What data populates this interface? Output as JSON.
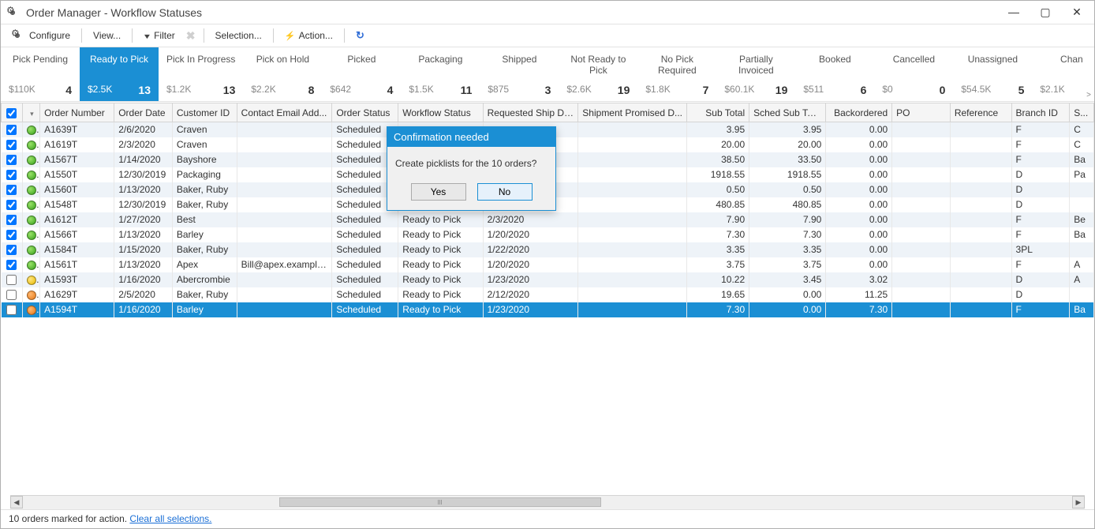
{
  "window": {
    "title": "Order Manager - Workflow Statuses"
  },
  "toolbar": {
    "configure": "Configure",
    "view": "View...",
    "filter": "Filter",
    "selection": "Selection...",
    "action": "Action...",
    "refresh": ""
  },
  "tabs": [
    {
      "name": "Pick Pending",
      "amount": "$110K",
      "count": "4"
    },
    {
      "name": "Ready to Pick",
      "amount": "$2.5K",
      "count": "13"
    },
    {
      "name": "Pick In Progress",
      "amount": "$1.2K",
      "count": "13"
    },
    {
      "name": "Pick on Hold",
      "amount": "$2.2K",
      "count": "8"
    },
    {
      "name": "Picked",
      "amount": "$642",
      "count": "4"
    },
    {
      "name": "Packaging",
      "amount": "$1.5K",
      "count": "11"
    },
    {
      "name": "Shipped",
      "amount": "$875",
      "count": "3"
    },
    {
      "name": "Not Ready to Pick",
      "amount": "$2.6K",
      "count": "19"
    },
    {
      "name": "No Pick Required",
      "amount": "$1.8K",
      "count": "7"
    },
    {
      "name": "Partially Invoiced",
      "amount": "$60.1K",
      "count": "19"
    },
    {
      "name": "Booked",
      "amount": "$511",
      "count": "6"
    },
    {
      "name": "Cancelled",
      "amount": "$0",
      "count": "0"
    },
    {
      "name": "Unassigned",
      "amount": "$54.5K",
      "count": "5"
    },
    {
      "name": "Chan",
      "amount": "$2.1K",
      "count": ""
    }
  ],
  "columns": {
    "order_number": "Order Number",
    "order_date": "Order Date",
    "customer_id": "Customer ID",
    "contact_email": "Contact Email Add...",
    "order_status": "Order Status",
    "workflow_status": "Workflow Status",
    "requested_ship": "Requested Ship Date",
    "promised": "Shipment Promised D...",
    "sub_total": "Sub Total",
    "sched_sub_total": "Sched Sub Total",
    "backordered": "Backordered",
    "po": "PO",
    "reference": "Reference",
    "branch_id": "Branch ID",
    "last": "S..."
  },
  "rows": [
    {
      "chk": true,
      "dot": "green",
      "num": "A1639T",
      "date": "2/6/2020",
      "cust": "Craven",
      "email": "",
      "ostat": "Scheduled",
      "wstat": "",
      "req": "",
      "prom": "",
      "sub": "3.95",
      "sched": "3.95",
      "back": "0.00",
      "po": "",
      "ref": "",
      "branch": "F",
      "last": "C"
    },
    {
      "chk": true,
      "dot": "green",
      "num": "A1619T",
      "date": "2/3/2020",
      "cust": "Craven",
      "email": "",
      "ostat": "Scheduled",
      "wstat": "",
      "req": "",
      "prom": "",
      "sub": "20.00",
      "sched": "20.00",
      "back": "0.00",
      "po": "",
      "ref": "",
      "branch": "F",
      "last": "C"
    },
    {
      "chk": true,
      "dot": "green",
      "num": "A1567T",
      "date": "1/14/2020",
      "cust": "Bayshore",
      "email": "",
      "ostat": "Scheduled",
      "wstat": "",
      "req": "",
      "prom": "",
      "sub": "38.50",
      "sched": "33.50",
      "back": "0.00",
      "po": "",
      "ref": "",
      "branch": "F",
      "last": "Ba"
    },
    {
      "chk": true,
      "dot": "green",
      "num": "A1550T",
      "date": "12/30/2019",
      "cust": "Packaging",
      "email": "",
      "ostat": "Scheduled",
      "wstat": "",
      "req": "",
      "prom": "",
      "sub": "1918.55",
      "sched": "1918.55",
      "back": "0.00",
      "po": "",
      "ref": "",
      "branch": "D",
      "last": "Pa"
    },
    {
      "chk": true,
      "dot": "green",
      "num": "A1560T",
      "date": "1/13/2020",
      "cust": "Baker, Ruby",
      "email": "",
      "ostat": "Scheduled",
      "wstat": "",
      "req": "",
      "prom": "",
      "sub": "0.50",
      "sched": "0.50",
      "back": "0.00",
      "po": "",
      "ref": "",
      "branch": "D",
      "last": ""
    },
    {
      "chk": true,
      "dot": "green",
      "num": "A1548T",
      "date": "12/30/2019",
      "cust": "Baker, Ruby",
      "email": "",
      "ostat": "Scheduled",
      "wstat": "",
      "req": "",
      "prom": "",
      "sub": "480.85",
      "sched": "480.85",
      "back": "0.00",
      "po": "",
      "ref": "",
      "branch": "D",
      "last": ""
    },
    {
      "chk": true,
      "dot": "green",
      "num": "A1612T",
      "date": "1/27/2020",
      "cust": "Best",
      "email": "",
      "ostat": "Scheduled",
      "wstat": "Ready to Pick",
      "req": "2/3/2020",
      "prom": "",
      "sub": "7.90",
      "sched": "7.90",
      "back": "0.00",
      "po": "",
      "ref": "",
      "branch": "F",
      "last": "Be"
    },
    {
      "chk": true,
      "dot": "green",
      "num": "A1566T",
      "date": "1/13/2020",
      "cust": "Barley",
      "email": "",
      "ostat": "Scheduled",
      "wstat": "Ready to Pick",
      "req": "1/20/2020",
      "prom": "",
      "sub": "7.30",
      "sched": "7.30",
      "back": "0.00",
      "po": "",
      "ref": "",
      "branch": "F",
      "last": "Ba"
    },
    {
      "chk": true,
      "dot": "green",
      "num": "A1584T",
      "date": "1/15/2020",
      "cust": "Baker, Ruby",
      "email": "",
      "ostat": "Scheduled",
      "wstat": "Ready to Pick",
      "req": "1/22/2020",
      "prom": "",
      "sub": "3.35",
      "sched": "3.35",
      "back": "0.00",
      "po": "",
      "ref": "",
      "branch": "3PL",
      "last": ""
    },
    {
      "chk": true,
      "dot": "green",
      "num": "A1561T",
      "date": "1/13/2020",
      "cust": "Apex",
      "email": "Bill@apex.example....",
      "ostat": "Scheduled",
      "wstat": "Ready to Pick",
      "req": "1/20/2020",
      "prom": "",
      "sub": "3.75",
      "sched": "3.75",
      "back": "0.00",
      "po": "",
      "ref": "",
      "branch": "F",
      "last": "A"
    },
    {
      "chk": false,
      "dot": "yellow",
      "num": "A1593T",
      "date": "1/16/2020",
      "cust": "Abercrombie",
      "email": "",
      "ostat": "Scheduled",
      "wstat": "Ready to Pick",
      "req": "1/23/2020",
      "prom": "",
      "sub": "10.22",
      "sched": "3.45",
      "back": "3.02",
      "po": "",
      "ref": "",
      "branch": "D",
      "last": "A"
    },
    {
      "chk": false,
      "dot": "orange",
      "num": "A1629T",
      "date": "2/5/2020",
      "cust": "Baker, Ruby",
      "email": "",
      "ostat": "Scheduled",
      "wstat": "Ready to Pick",
      "req": "2/12/2020",
      "prom": "",
      "sub": "19.65",
      "sched": "0.00",
      "back": "11.25",
      "po": "",
      "ref": "",
      "branch": "D",
      "last": ""
    },
    {
      "chk": false,
      "dot": "orange",
      "num": "A1594T",
      "date": "1/16/2020",
      "cust": "Barley",
      "email": "",
      "ostat": "Scheduled",
      "wstat": "Ready to Pick",
      "req": "1/23/2020",
      "prom": "",
      "sub": "7.30",
      "sched": "0.00",
      "back": "7.30",
      "po": "",
      "ref": "",
      "branch": "F",
      "last": "Ba",
      "selected": true
    }
  ],
  "status": {
    "text": "10 orders marked for action. ",
    "link": "Clear all selections."
  },
  "dialog": {
    "title": "Confirmation needed",
    "message": "Create picklists for the 10 orders?",
    "yes": "Yes",
    "no": "No"
  }
}
